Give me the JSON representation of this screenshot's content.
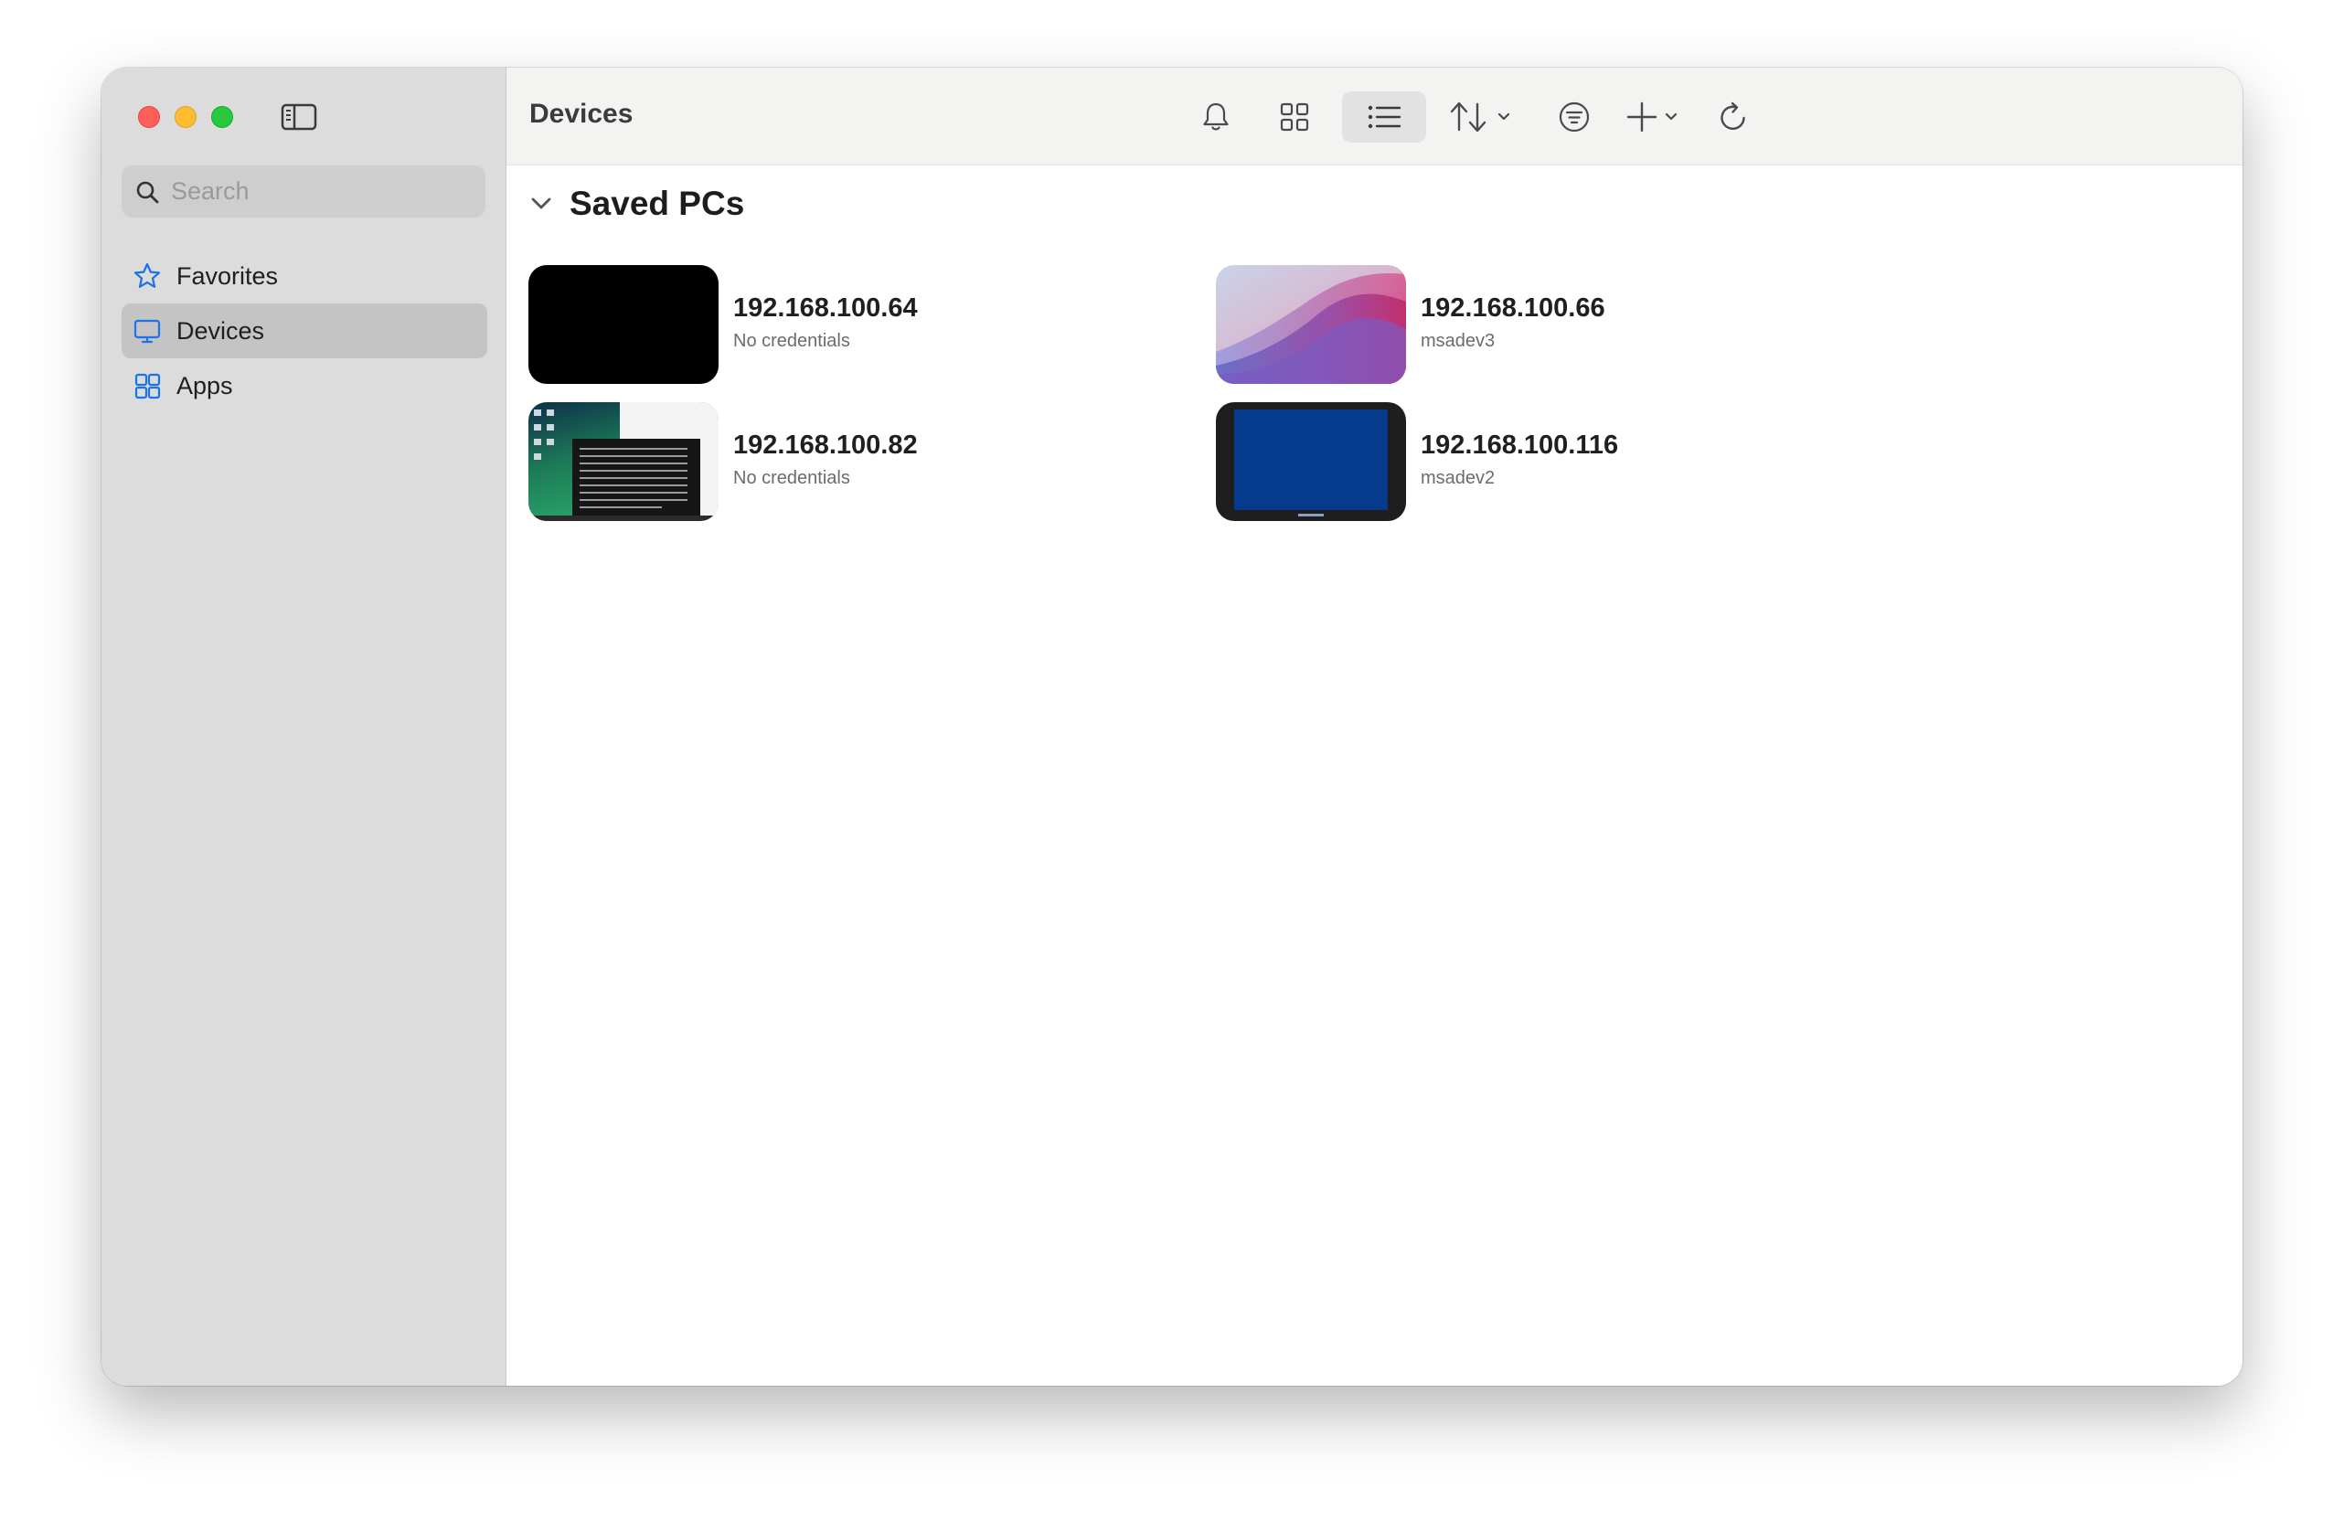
{
  "sidebar": {
    "search_placeholder": "Search",
    "items": [
      {
        "label": "Favorites",
        "icon": "star-icon",
        "selected": false
      },
      {
        "label": "Devices",
        "icon": "monitor-icon",
        "selected": true
      },
      {
        "label": "Apps",
        "icon": "apps-icon",
        "selected": false
      }
    ]
  },
  "toolbar": {
    "title": "Devices",
    "buttons": [
      {
        "icon": "bell-icon"
      },
      {
        "icon": "grid-view-icon"
      },
      {
        "icon": "list-view-icon",
        "active": true
      },
      {
        "icon": "sort-icon"
      },
      {
        "icon": "filter-icon"
      },
      {
        "icon": "add-icon"
      },
      {
        "icon": "refresh-icon"
      }
    ]
  },
  "section": {
    "title": "Saved PCs"
  },
  "devices": [
    {
      "name": "192.168.100.64",
      "subtitle": "No credentials",
      "thumbnail": "black-screen"
    },
    {
      "name": "192.168.100.66",
      "subtitle": "msadev3",
      "thumbnail": "purple-wave-wallpaper"
    },
    {
      "name": "192.168.100.82",
      "subtitle": "No credentials",
      "thumbnail": "desktop-with-terminal"
    },
    {
      "name": "192.168.100.116",
      "subtitle": "msadev2",
      "thumbnail": "blue-screen"
    }
  ],
  "colors": {
    "accent": "#1a73e8",
    "sidebar_bg": "#dcdcdc",
    "selected_bg": "#c4c4c4",
    "toolbar_bg": "#f3f3f2"
  }
}
